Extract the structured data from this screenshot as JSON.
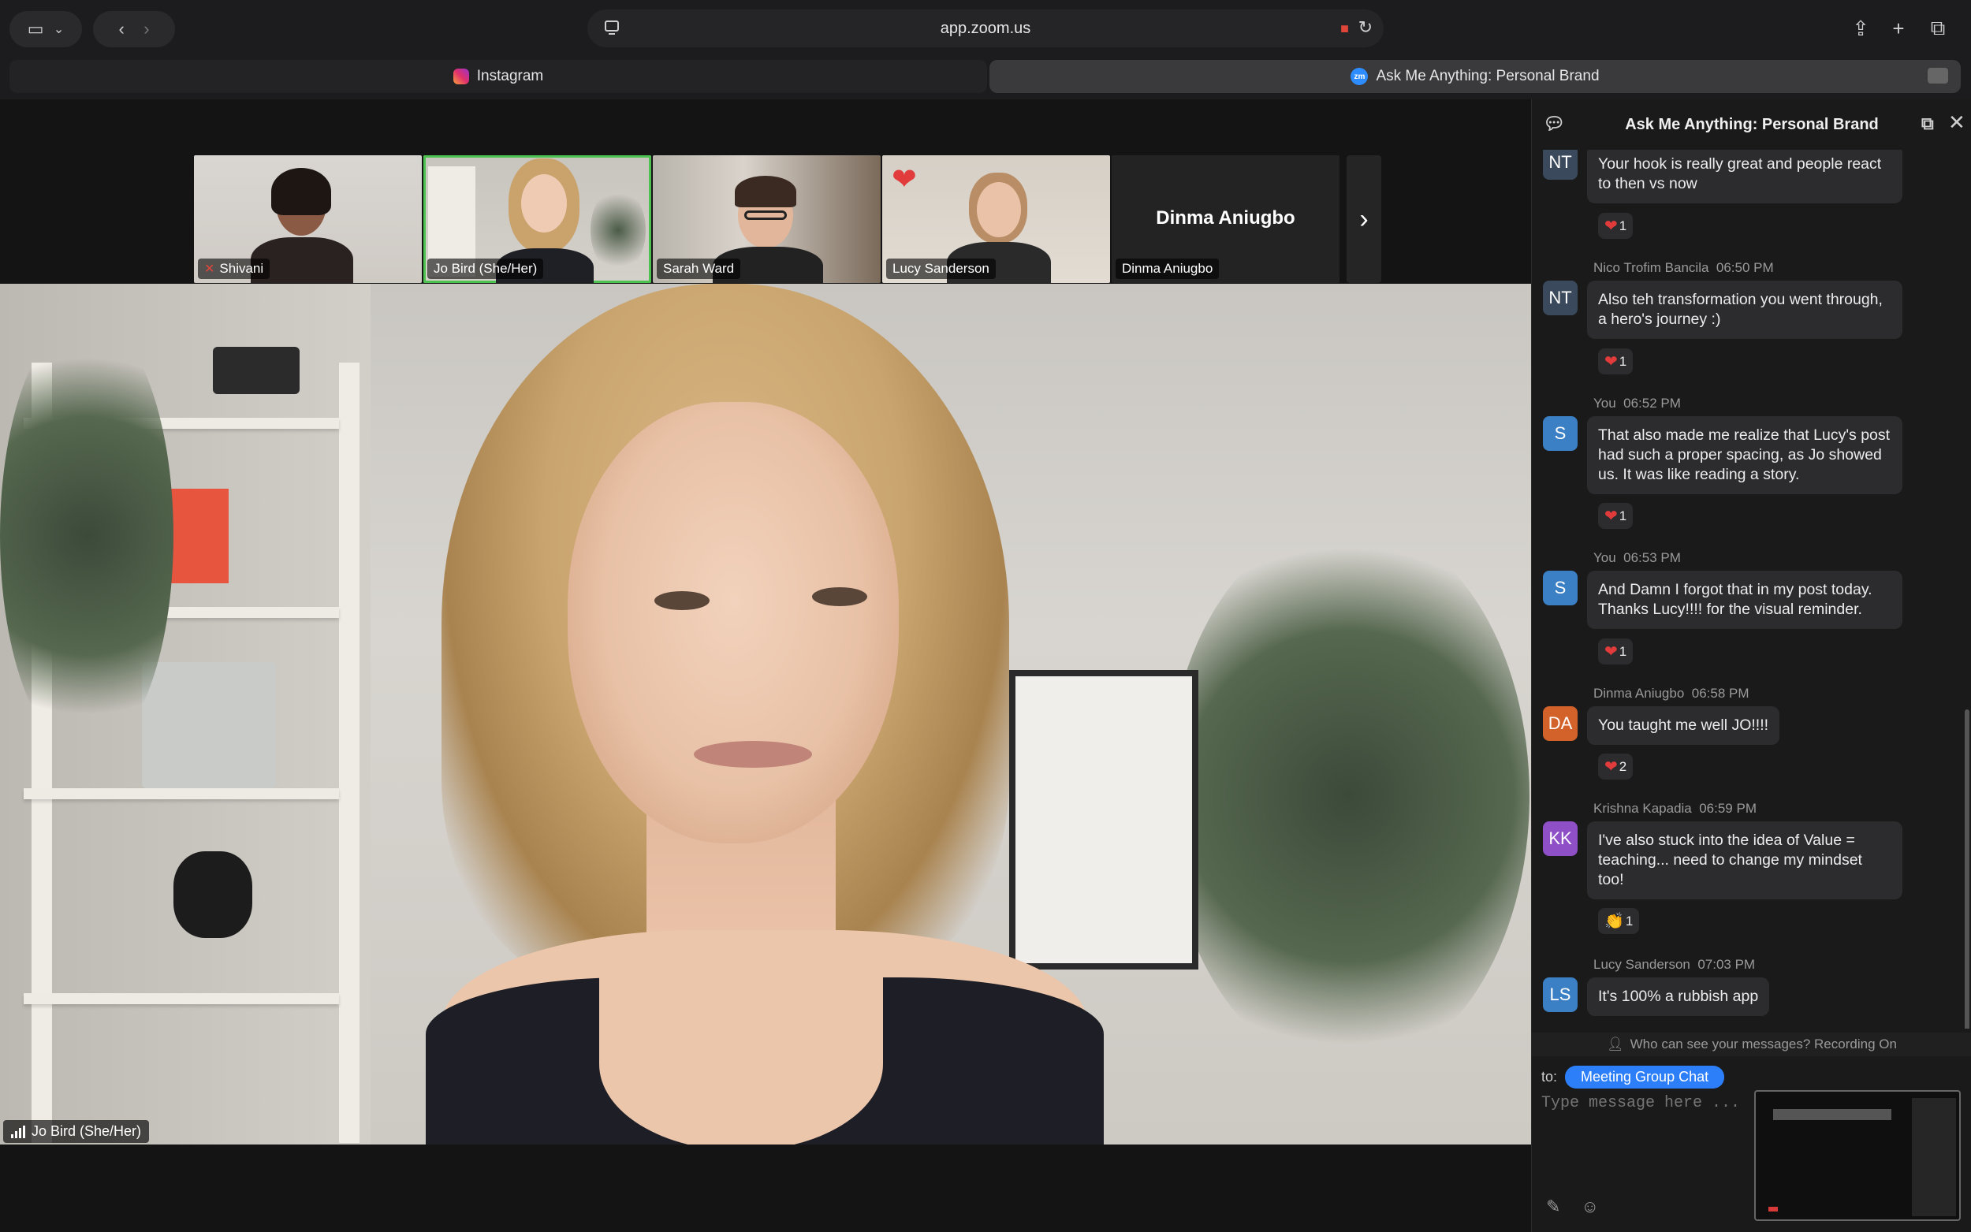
{
  "browser": {
    "url": "app.zoom.us",
    "tabs": [
      {
        "label": "Instagram",
        "icon": "instagram-icon"
      },
      {
        "label": "Ask Me Anything: Personal Brand",
        "icon": "zoom-icon"
      }
    ]
  },
  "gallery": {
    "participants": [
      {
        "name": "Shivani",
        "muted": true
      },
      {
        "name": "Jo Bird (She/Her)",
        "active": true
      },
      {
        "name": "Sarah Ward"
      },
      {
        "name": "Lucy Sanderson",
        "reaction": "heart"
      },
      {
        "name": "Dinma Aniugbo",
        "display_name": "Dinma Aniugbo",
        "video_off": true
      }
    ]
  },
  "main_video": {
    "speaker": "Jo Bird (She/Her)"
  },
  "chat": {
    "title": "Ask Me Anything: Personal Brand",
    "messages": [
      {
        "sender": "",
        "time": "",
        "initials": "NT",
        "color": "#3a4a5c",
        "text": "Your hook is really great and people react to then vs now",
        "reaction": "❤",
        "reaction_count": "1"
      },
      {
        "sender": "Nico Trofim Bancila",
        "time": "06:50 PM",
        "initials": "NT",
        "color": "#3a4a5c",
        "text": "Also teh transformation you went through, a hero's journey :)",
        "reaction": "❤",
        "reaction_count": "1"
      },
      {
        "sender": "You",
        "time": "06:52 PM",
        "initials": "S",
        "color": "#3b7fc4",
        "text": "That also made me realize that Lucy's post had such a proper spacing, as Jo showed us. It was like reading a story.",
        "reaction": "❤",
        "reaction_count": "1"
      },
      {
        "sender": "You",
        "time": "06:53 PM",
        "initials": "S",
        "color": "#3b7fc4",
        "text": "And Damn I forgot that in my post today. Thanks Lucy!!!! for the visual reminder.",
        "reaction": "❤",
        "reaction_count": "1"
      },
      {
        "sender": "Dinma Aniugbo",
        "time": "06:58 PM",
        "initials": "DA",
        "color": "#d3622a",
        "text": "You taught me well JO!!!!",
        "reaction": "❤",
        "reaction_count": "2"
      },
      {
        "sender": "Krishna Kapadia",
        "time": "06:59 PM",
        "initials": "KK",
        "color": "#8e4fc7",
        "text": "I've also stuck into the idea of Value = teaching... need to change my mindset too!",
        "reaction": "👏",
        "reaction_count": "1"
      },
      {
        "sender": "Lucy Sanderson",
        "time": "07:03 PM",
        "initials": "LS",
        "color": "#3b7fc4",
        "text": "It's 100% a rubbish app",
        "reaction": "",
        "reaction_count": ""
      }
    ],
    "privacy_note": "Who can see your messages? Recording On",
    "to_label": "to:",
    "recipient": "Meeting Group Chat",
    "input_placeholder": "Type message here ..."
  }
}
